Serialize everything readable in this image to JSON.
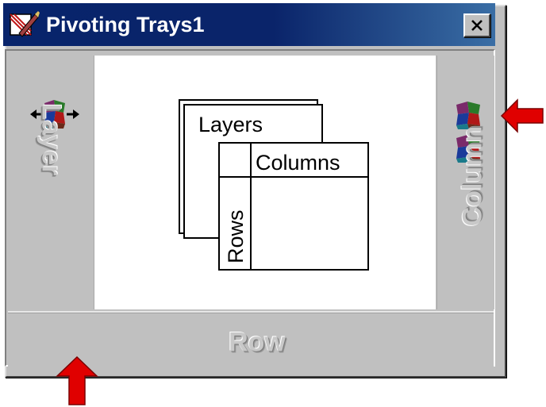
{
  "window": {
    "title": "Pivoting Trays1",
    "close_glyph": "close-icon"
  },
  "trays": {
    "layer_label": "Layer",
    "column_label": "Column",
    "row_label": "Row",
    "layer_icon": "pivot-icon-with-arrows",
    "column_icons": [
      "pivot-icon",
      "pivot-icon"
    ]
  },
  "diagram": {
    "layers_label": "Layers",
    "columns_label": "Columns",
    "rows_label": "Rows"
  },
  "annotations": {
    "arrow_color": "#e00000",
    "arrows": [
      "red-arrow-left",
      "red-arrow-up"
    ]
  },
  "colors": {
    "titlebar": "#0a246a",
    "face": "#c0c0c0",
    "canvas": "#ffffff"
  }
}
